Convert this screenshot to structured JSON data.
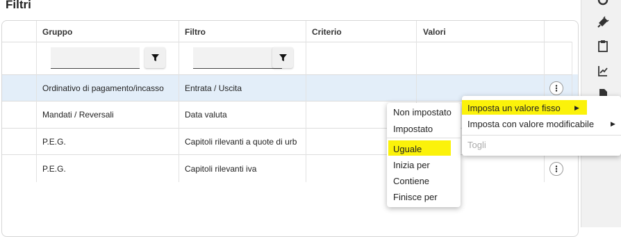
{
  "page": {
    "title": "Filtri"
  },
  "table": {
    "headers": {
      "gruppo": "Gruppo",
      "filtro": "Filtro",
      "criterio": "Criterio",
      "valori": "Valori"
    },
    "rows": [
      {
        "gruppo": "Ordinativo di pagamento/incasso",
        "filtro": "Entrata / Uscita",
        "selected": true
      },
      {
        "gruppo": "Mandati / Reversali",
        "filtro": "Data valuta"
      },
      {
        "gruppo": "P.E.G.",
        "filtro": "Capitoli rilevanti a quote di urb"
      },
      {
        "gruppo": "P.E.G.",
        "filtro": "Capitoli rilevanti iva"
      }
    ]
  },
  "menus": {
    "criteria": {
      "items": [
        {
          "label": "Non impostato"
        },
        {
          "label": "Impostato"
        },
        {
          "label": "Uguale",
          "highlighted": true
        },
        {
          "label": "Inizia per"
        },
        {
          "label": "Contiene"
        },
        {
          "label": "Finisce per"
        }
      ]
    },
    "value": {
      "items": [
        {
          "label": "Imposta un valore fisso",
          "highlighted": true
        },
        {
          "label": "Imposta con valore modificabile"
        },
        {
          "label": "Togli",
          "disabled": true
        }
      ]
    }
  },
  "icons": {
    "filter_button": "filter-icon",
    "row_actions": "more-vert-icon",
    "rail": [
      "settings-icon",
      "plug-icon",
      "clipboard-icon",
      "chart-export-icon",
      "document-icon"
    ]
  },
  "colors": {
    "selection": "#e3eef9",
    "highlight": "#fbf20a"
  }
}
